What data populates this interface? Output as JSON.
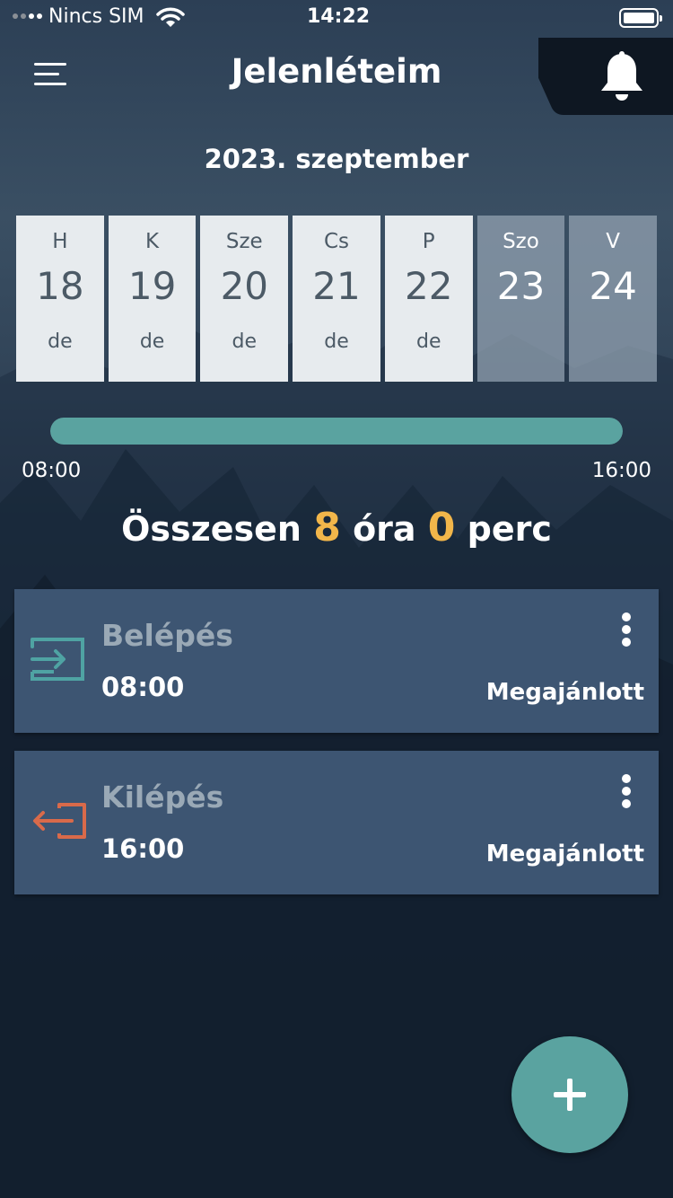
{
  "status_bar": {
    "carrier": "Nincs SIM",
    "time": "14:22"
  },
  "header": {
    "title": "Jelenléteim",
    "menu_icon": "menu-icon",
    "bell_icon": "bell-icon"
  },
  "month_label": "2023. szeptember",
  "days": [
    {
      "name": "H",
      "date": "18",
      "period": "de",
      "weekend": false
    },
    {
      "name": "K",
      "date": "19",
      "period": "de",
      "weekend": false
    },
    {
      "name": "Sze",
      "date": "20",
      "period": "de",
      "weekend": false
    },
    {
      "name": "Cs",
      "date": "21",
      "period": "de",
      "weekend": false
    },
    {
      "name": "P",
      "date": "22",
      "period": "de",
      "weekend": false
    },
    {
      "name": "Szo",
      "date": "23",
      "period": "",
      "weekend": true
    },
    {
      "name": "V",
      "date": "24",
      "period": "",
      "weekend": true
    }
  ],
  "timeline": {
    "start": "08:00",
    "end": "16:00",
    "progress": 1.0
  },
  "total": {
    "prefix": "Összesen",
    "hours": "8",
    "hours_unit": "óra",
    "minutes": "0",
    "minutes_unit": "perc"
  },
  "entries": [
    {
      "label": "Belépés",
      "time": "08:00",
      "status": "Megajánlott",
      "icon": "login-icon"
    },
    {
      "label": "Kilépés",
      "time": "16:00",
      "status": "Megajánlott",
      "icon": "logout-icon"
    }
  ],
  "colors": {
    "accent": "#5aa3a0",
    "highlight": "#f2b64a",
    "card": "#3d5572",
    "login_icon": "#4fa3a3",
    "logout_icon": "#d96a4a"
  },
  "fab": {
    "icon": "plus-icon"
  }
}
